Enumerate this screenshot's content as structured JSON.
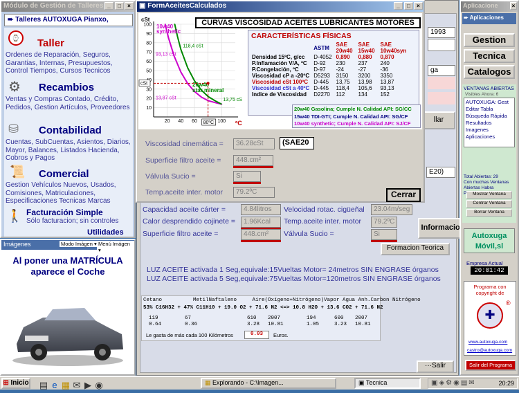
{
  "left_window": {
    "title": "Módulo de Gestión de Talleres",
    "header": "Talleres AUTOXUGA Pianxo,",
    "sections": [
      {
        "title": "Taller",
        "links": "Ordenes de Reparación, Seguros, Garantias, Internas, Presupuestos, Control Tiempos, Cursos Tecnicos"
      },
      {
        "title": "Recambios",
        "links": "Ventas y Compras Contado, Crédito, Pedidos, Gestion Artículos, Proveedores"
      },
      {
        "title": "Contabilidad",
        "links": "Cuentas, SubCuentas, Asientos, Diarios, Mayor, Balances, Listados Hacienda, Cobros y Pagos"
      },
      {
        "title": "Comercial",
        "links": "Gestion Vehículos Nuevos, Usados, Comisiones, Matriculaciones, Especificaciones Tecnicas Marcas"
      }
    ],
    "facturacion_title": "Facturación Simple",
    "facturacion_desc": "Sólo facturacion; sin controles",
    "utilidades": "Utilidades"
  },
  "images_panel": {
    "title": "Imágenes",
    "mode_button": "Modo Imágen",
    "menu_button": "Menú Imágen",
    "caption": "Al poner una MATRÍCULA aparece el Coche"
  },
  "dialog": {
    "title": "FormAceitesCalculados",
    "chart_title": "CURVAS VISCOSIDAD ACEITES LUBRICANTES MOTORES",
    "props_title": "CARACTERÍSTICAS FÍSICAS",
    "props_headers": [
      "ASTM",
      "SAE 20w40",
      "SAE 15w40",
      "SAE 10w40syn"
    ],
    "props_rows": [
      {
        "label": "Densidad 15ºC, g/cc",
        "astm": "D-4052",
        "v1": "0,890",
        "v2": "0,880",
        "v3": "0,870"
      },
      {
        "label": "P.Inflamación V/A, ºC",
        "astm": "D-92",
        "v1": "230",
        "v2": "237",
        "v3": "240"
      },
      {
        "label": "P.Congelación, ºC",
        "astm": "D-97",
        "v1": "-24",
        "v2": "-27",
        "v3": "-36"
      },
      {
        "label": "Viscosidad cP a -20ºC",
        "astm": "D5293",
        "v1": "3150",
        "v2": "3200",
        "v3": "3350"
      },
      {
        "label": "Viscosidad cSt 100ºC",
        "astm": "D-445",
        "v1": "13,75",
        "v2": "13,98",
        "v3": "13,87"
      },
      {
        "label": "Viscosidad cSt a 40ºC",
        "astm": "D-445",
        "v1": "118,4",
        "v2": "105,6",
        "v3": "93,13"
      },
      {
        "label": "Indice de Viscosidad",
        "astm": "D2270",
        "v1": "112",
        "v2": "134",
        "v3": "152"
      }
    ],
    "api_lines": [
      "20w40 Gasolina; Cumple N. Calidad API: SG/CC",
      "15w40 TDI-GTI; Cumple N. Calidad API: SG/CF",
      "10w40 synthetic; Cumple N. Calidad API: SJ/CF"
    ],
    "form": {
      "visc_label": "Viscosidad cinemática =",
      "visc_value": "36.28cSt",
      "sae_value": "(SAE20",
      "filtro_label": "Superficie filtro aceite =",
      "filtro_value": "448.cm²",
      "valvula_label": "Válvula Sucio =",
      "valvula_value": "Si",
      "temp_label": "Temp.aceite inter. motor",
      "temp_value": "79.2ºC",
      "cerrar": "Cerrar"
    }
  },
  "chart_data": {
    "type": "line",
    "xlabel": "ºC",
    "ylabel": "cSt",
    "xlim": [
      0,
      120
    ],
    "ylim": [
      0,
      100
    ],
    "x_ticks": [
      20,
      40,
      60,
      80,
      100
    ],
    "y_ticks": [
      10,
      20,
      30,
      40,
      50,
      60,
      70,
      80,
      90,
      100
    ],
    "series": [
      {
        "name": "10w40 synthetic",
        "color": "#cc00cc",
        "x": [
          17,
          22,
          30,
          40,
          50,
          60,
          70,
          80,
          90,
          100
        ],
        "y": [
          100,
          85,
          66,
          48.5,
          36,
          27.5,
          21.5,
          17.5,
          15.5,
          13.75
        ]
      },
      {
        "name": "20w40 star mineral",
        "color": "#008800",
        "x": [
          31,
          35,
          40,
          50,
          60,
          70,
          80,
          90,
          100
        ],
        "y": [
          100,
          87,
          73,
          53,
          39,
          29,
          22,
          17.5,
          13.75
        ]
      }
    ],
    "annotations": [
      "118,4 cSt",
      "93,13 cSt",
      "13,87 cSt",
      "13,75 cSt",
      "cSt",
      "80ºC"
    ],
    "markers": {
      "sample_x": 80,
      "sample_y": 36.28
    }
  },
  "behind": {
    "date": "1993",
    "gestion_label": "ga",
    "llar": "llar",
    "e20": "E20)",
    "labels": [
      "Capacidad aceite cárter =",
      "Calor desprendido cojinete =",
      "Superficie filtro aceite ="
    ],
    "values": [
      "4.84litros",
      "1.96Kcal",
      "448.cm²"
    ],
    "labels2": [
      "Velocidad rotac. cigüeñal",
      "Temp.aceite inter. motor",
      "Válvula Sucio ="
    ],
    "values2": [
      "23.04m/seg",
      "79.2ºC",
      "Si"
    ],
    "info_btn": "Informacion",
    "formacion_btn": "Formacion Teorica",
    "luz1": "LUZ ACEITE activada 1 Seg,equivale:15Vueltas Motor= 24metros SIN ENGRASE órganos",
    "luz2": "LUZ ACEITE activada 5 Seg,equivale:75Vueltas Motor=120metros SIN ENGRASE órganos",
    "chem_headers": "Cetano          MetilNaftaleno     Aire(Oxígeno+Nitrógeno)Vapor Agua Anh.Carbon Nitrógeno",
    "chem_formula": "53% C16H32 + 47% C11H10 + 19.0 O2 + 71.6 N2 <=> 10.8 H2O + 13.6 CO2 + 71.6 N2",
    "chem_rows": [
      [
        "119",
        "67",
        "610",
        "2007",
        "",
        "194",
        "600",
        "2007"
      ],
      [
        "0.64",
        "0.36",
        "3.28",
        "10.81",
        "",
        "1.05",
        "3.23",
        "10.81"
      ]
    ],
    "gasta_label": "Le gasta de más cada 100 Kilómetros",
    "gasta_value": "0.03",
    "gasta_unit": "Euros.",
    "salir": "Salir"
  },
  "right_panel": {
    "title": "Aplicacione",
    "apps_btn": "Aplicaciones",
    "gestion": "Gestion",
    "tecnica": "Tecnica",
    "catalogos": "Catalogos",
    "ventanas_title": "VENTANAS ABIERTAS",
    "visibles": "Visibles Ahora: 6",
    "window_list": [
      "AUTOXUGA: Gest",
      "Editar Tabla",
      "Búsqueda Rápida",
      "Resultados",
      "Imagenes",
      "Aplicaciones"
    ],
    "total": "Total Abiertas: 29",
    "con_muchas": "Con muchas Ventanas Abiertas Habra Problemas",
    "mostrar": "Mostrar Ventana",
    "centrar": "Centrar Ventana",
    "borrar": "Borrar Ventana",
    "logo": "Autoxuga Móvil,sl",
    "empresa": "Empresa Actual",
    "clock": "20:01:42",
    "programa": "Programa con copyright de",
    "web": "www.autoxuga.com",
    "email": "castro@autoxuga.com",
    "salir_prog": "Salir del Programa"
  },
  "taskbar": {
    "start": "Inicio",
    "tasks": [
      "Explorando - C:\\Imagen...",
      "Tecnica"
    ],
    "time": "20:29"
  }
}
